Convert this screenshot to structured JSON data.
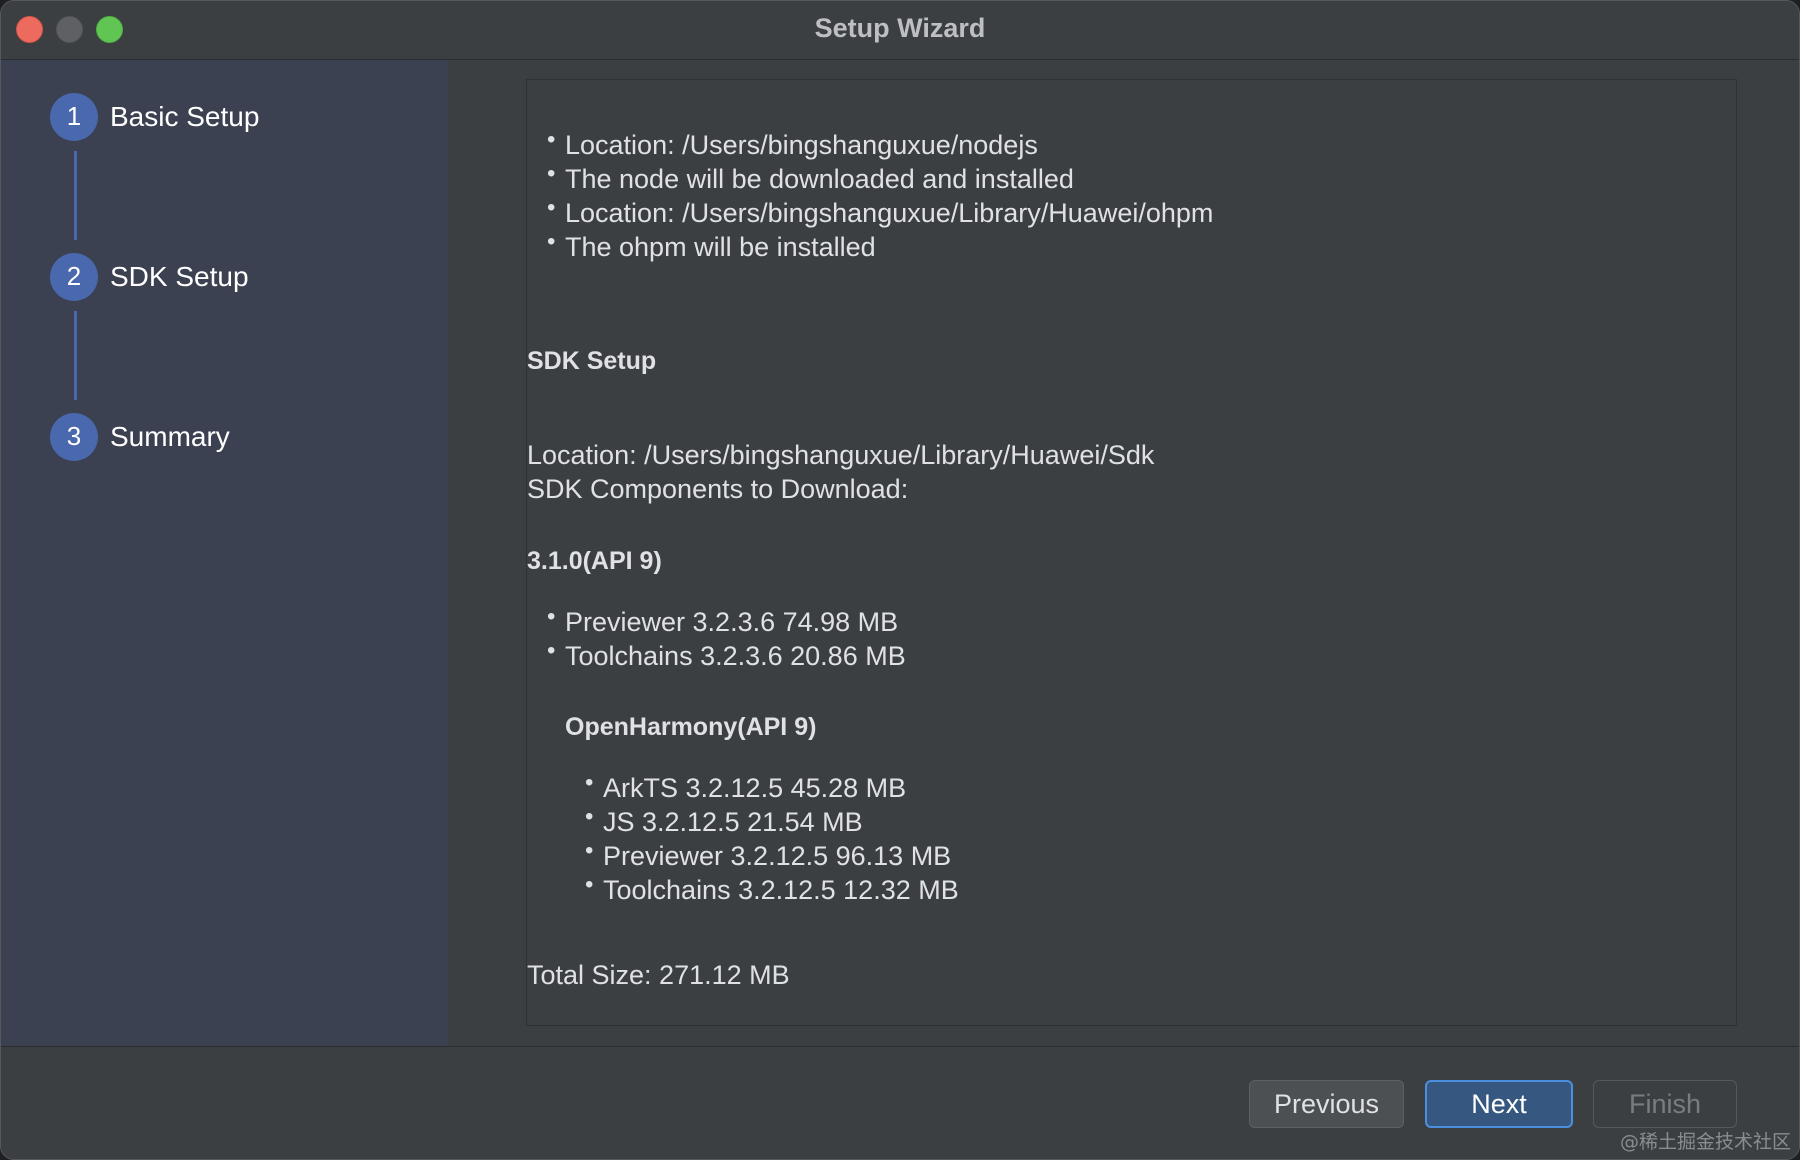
{
  "window": {
    "title": "Setup Wizard"
  },
  "sidebar": {
    "steps": [
      {
        "number": "1",
        "label": "Basic Setup"
      },
      {
        "number": "2",
        "label": "SDK Setup"
      },
      {
        "number": "3",
        "label": "Summary"
      }
    ]
  },
  "content": {
    "basic_items": [
      "Location: /Users/bingshanguxue/nodejs",
      "The node will be downloaded and installed",
      "Location: /Users/bingshanguxue/Library/Huawei/ohpm",
      "The ohpm will be installed"
    ],
    "sdk_heading": "SDK Setup",
    "sdk_location": "Location: /Users/bingshanguxue/Library/Huawei/Sdk",
    "sdk_components_label": "SDK Components to Download:",
    "api_heading": "3.1.0(API 9)",
    "api_components": [
      "Previewer  3.2.3.6  74.98 MB",
      "Toolchains  3.2.3.6  20.86 MB"
    ],
    "openharmony_heading": "OpenHarmony(API 9)",
    "openharmony_components": [
      "ArkTS  3.2.12.5  45.28 MB",
      "JS  3.2.12.5  21.54 MB",
      "Previewer  3.2.12.5  96.13 MB",
      "Toolchains  3.2.12.5  12.32 MB"
    ],
    "total_size": "Total Size: 271.12 MB"
  },
  "footer": {
    "previous_label": "Previous",
    "next_label": "Next",
    "finish_label": "Finish"
  },
  "watermark": "@稀土掘金技术社区",
  "colors": {
    "accent": "#4a68ad",
    "next_button_border": "#4a8fe0",
    "sidebar_bg": "#3b4150"
  }
}
